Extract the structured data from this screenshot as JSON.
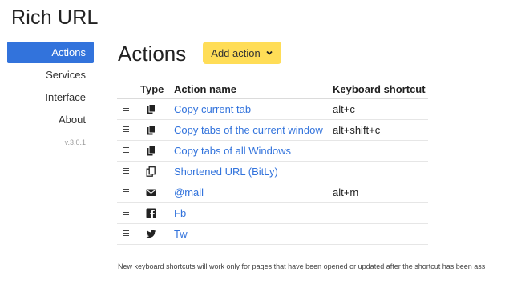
{
  "app": {
    "title": "Rich URL"
  },
  "sidebar": {
    "items": [
      {
        "label": "Actions",
        "active": true
      },
      {
        "label": "Services",
        "active": false
      },
      {
        "label": "Interface",
        "active": false
      },
      {
        "label": "About",
        "active": false
      }
    ],
    "version": "v.3.0.1"
  },
  "main": {
    "title": "Actions",
    "add_button_label": "Add action",
    "table": {
      "headers": {
        "type": "Type",
        "name": "Action name",
        "shortcut": "Keyboard shortcut"
      },
      "rows": [
        {
          "icon": "copy-icon",
          "name": "Copy current tab",
          "shortcut": "alt+c"
        },
        {
          "icon": "copy-icon",
          "name": "Copy tabs of the current window",
          "shortcut": "alt+shift+c"
        },
        {
          "icon": "copy-icon",
          "name": "Copy tabs of all Windows",
          "shortcut": ""
        },
        {
          "icon": "copy-outline-icon",
          "name": "Shortened URL (BitLy)",
          "shortcut": ""
        },
        {
          "icon": "envelope-icon",
          "name": "@mail",
          "shortcut": "alt+m"
        },
        {
          "icon": "facebook-icon",
          "name": "Fb",
          "shortcut": ""
        },
        {
          "icon": "twitter-icon",
          "name": "Tw",
          "shortcut": ""
        }
      ]
    },
    "footnote": "New keyboard shortcuts will work only for pages that have been opened or updated after the shortcut has been ass"
  },
  "colors": {
    "accent": "#3273dc",
    "button": "#ffdd57"
  }
}
